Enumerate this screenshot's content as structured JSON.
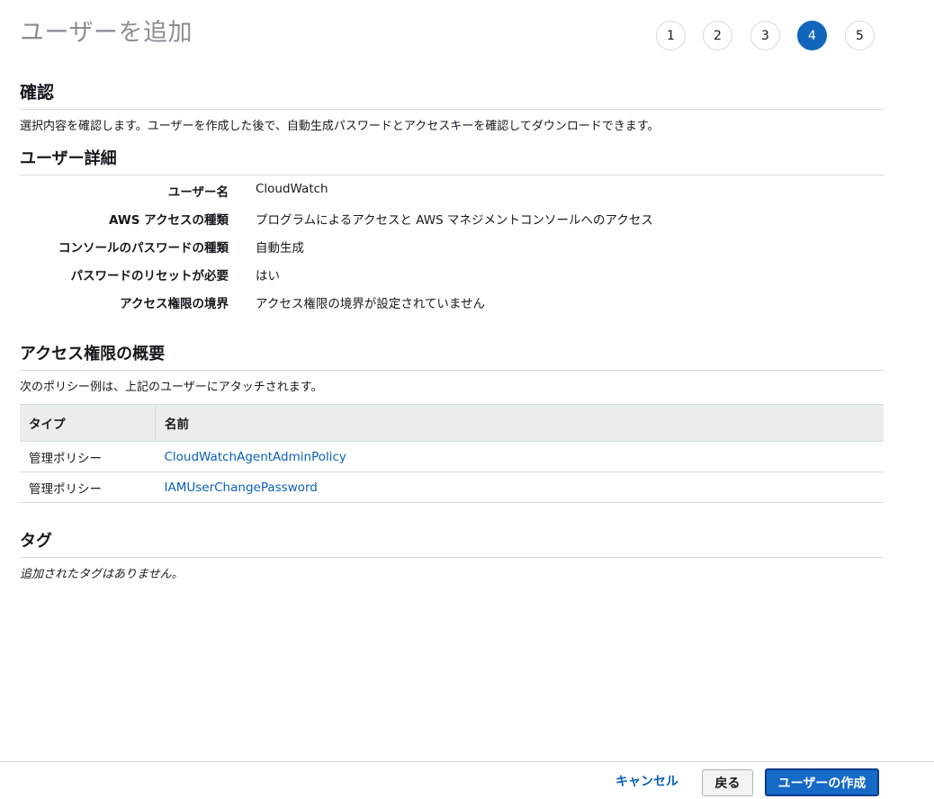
{
  "title": "ユーザーを追加",
  "steps": [
    {
      "label": "1",
      "active": false
    },
    {
      "label": "2",
      "active": false
    },
    {
      "label": "3",
      "active": false
    },
    {
      "label": "4",
      "active": true
    },
    {
      "label": "5",
      "active": false
    }
  ],
  "review": {
    "title": "確認",
    "description": "選択内容を確認します。ユーザーを作成した後で、自動生成パスワードとアクセスキーを確認してダウンロードできます。"
  },
  "user_details": {
    "title": "ユーザー詳細",
    "rows": [
      {
        "key": "ユーザー名",
        "value": "CloudWatch"
      },
      {
        "key": "AWS アクセスの種類",
        "value": "プログラムによるアクセスと AWS マネジメントコンソールへのアクセス"
      },
      {
        "key": "コンソールのパスワードの種類",
        "value": "自動生成"
      },
      {
        "key": "パスワードのリセットが必要",
        "value": "はい"
      },
      {
        "key": "アクセス権限の境界",
        "value": "アクセス権限の境界が設定されていません"
      }
    ]
  },
  "permissions": {
    "title": "アクセス権限の概要",
    "description": "次のポリシー例は、上記のユーザーにアタッチされます。",
    "columns": [
      "タイプ",
      "名前"
    ],
    "rows": [
      {
        "type": "管理ポリシー",
        "name": "CloudWatchAgentAdminPolicy"
      },
      {
        "type": "管理ポリシー",
        "name": "IAMUserChangePassword"
      }
    ]
  },
  "tags": {
    "title": "タグ",
    "empty_text": "追加されたタグはありません。"
  },
  "footer": {
    "cancel_label": "キャンセル",
    "back_label": "戻る",
    "create_label": "ユーザーの作成"
  },
  "colors": {
    "accent": "#1166bb",
    "link": "#0a62b8",
    "primary_button": "#1569c7"
  }
}
